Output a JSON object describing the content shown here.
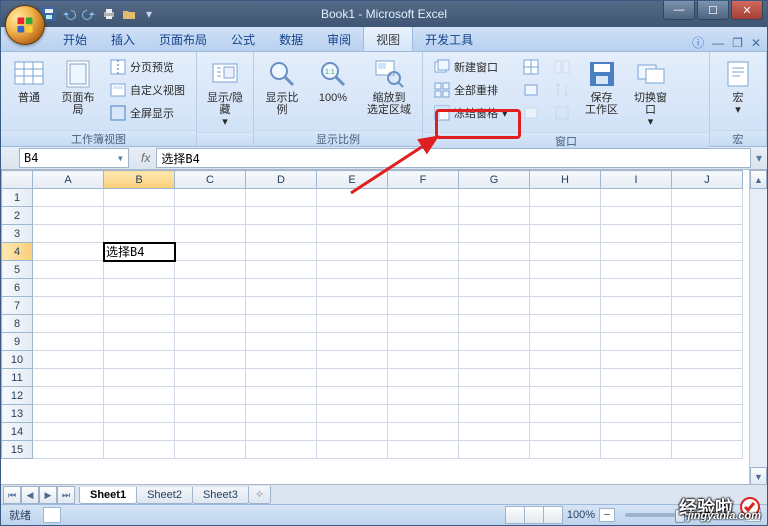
{
  "window": {
    "title": "Book1 - Microsoft Excel"
  },
  "qat": {
    "save": "save-icon",
    "undo": "undo-icon",
    "redo": "redo-icon",
    "print": "print-icon",
    "open": "open-icon"
  },
  "tabs": {
    "items": [
      "开始",
      "插入",
      "页面布局",
      "公式",
      "数据",
      "审阅",
      "视图",
      "开发工具"
    ],
    "active": "视图"
  },
  "ribbon": {
    "group_views": {
      "label": "工作簿视图",
      "normal": "普通",
      "page_layout": "页面布局",
      "page_break": "分页预览",
      "custom_views": "自定义视图",
      "full_screen": "全屏显示"
    },
    "group_showhide": {
      "label": "",
      "btn": "显示/隐藏"
    },
    "group_zoom": {
      "label": "显示比例",
      "zoom": "显示比例",
      "hundred": "100%",
      "to_selection_l1": "缩放到",
      "to_selection_l2": "选定区域"
    },
    "group_window": {
      "label": "窗口",
      "new_window": "新建窗口",
      "arrange_all": "全部重排",
      "freeze": "冻结窗格",
      "save_ws": "保存",
      "save_ws2": "工作区",
      "switch": "切换窗口"
    },
    "group_macro": {
      "label": "宏",
      "btn": "宏"
    }
  },
  "namebox": {
    "ref": "B4",
    "fx": "fx",
    "formula": "选择B4"
  },
  "grid": {
    "cols": [
      "A",
      "B",
      "C",
      "D",
      "E",
      "F",
      "G",
      "H",
      "I",
      "J"
    ],
    "rows": 15,
    "active_col": "B",
    "active_row": 4,
    "b4": "选择B4"
  },
  "sheets": {
    "items": [
      "Sheet1",
      "Sheet2",
      "Sheet3"
    ],
    "active": "Sheet1"
  },
  "status": {
    "ready": "就绪",
    "zoom": "100%",
    "minus": "−",
    "plus": "+"
  },
  "watermark": {
    "brand": "经验啦",
    "url": "jingyanla.com"
  }
}
